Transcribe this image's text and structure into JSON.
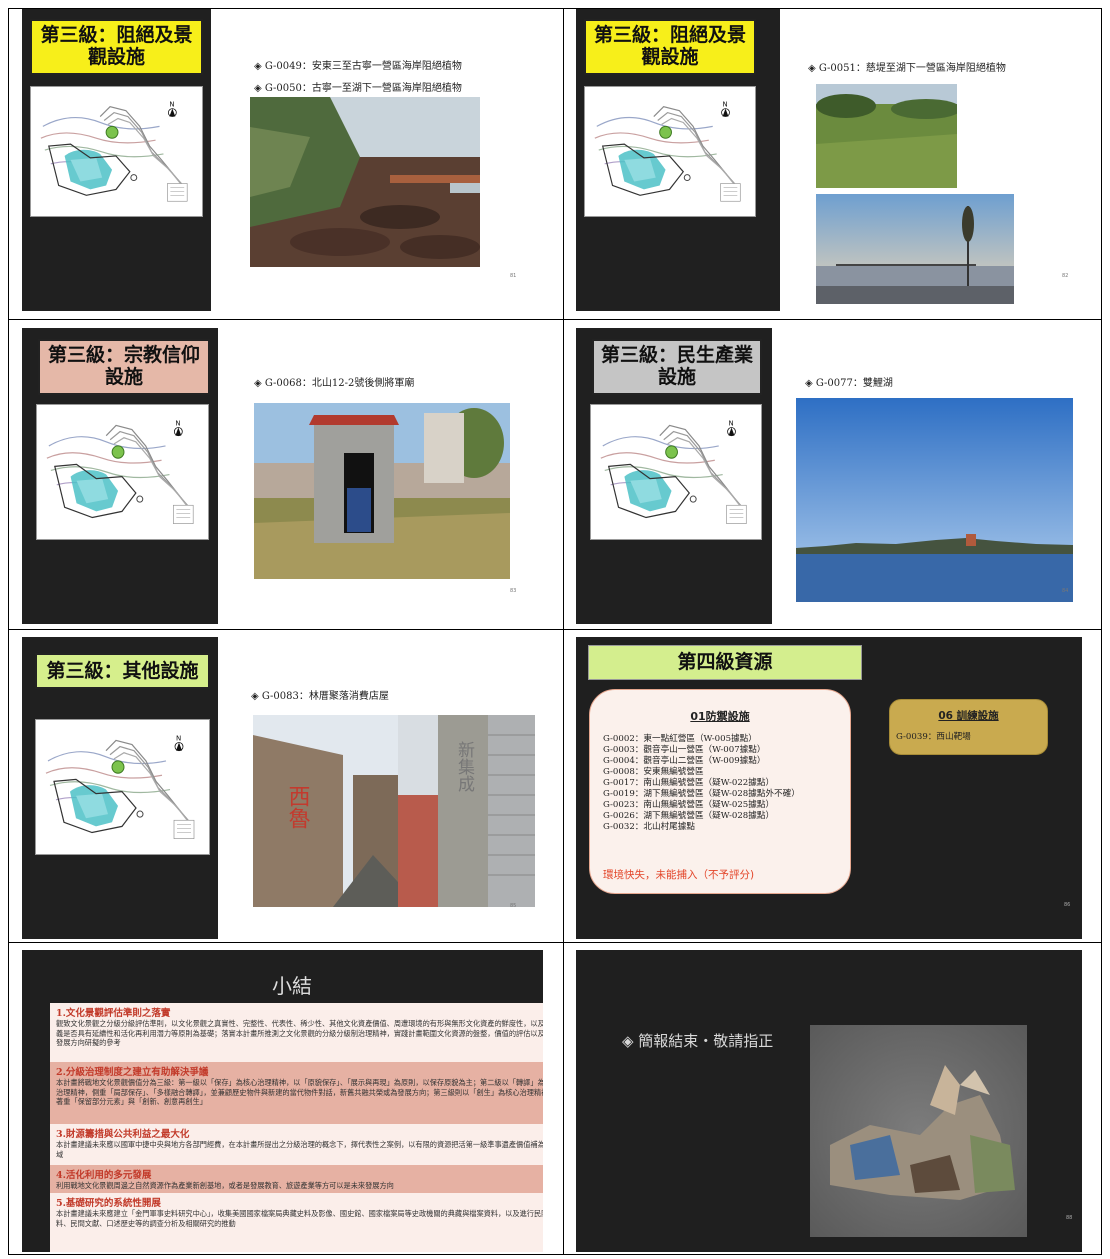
{
  "slides": {
    "s1": {
      "title": "第三級：阻絕及景觀設施",
      "captions": [
        "◈ G-0049：安東三至古寧一營區海岸阻絕植物",
        "◈ G-0050：古寧一至湖下一營區海岸阻絕植物"
      ],
      "page": "81"
    },
    "s2": {
      "title": "第三級：阻絕及景觀設施",
      "captions": [
        "◈ G-0051：慈堤至湖下一營區海岸阻絕植物"
      ],
      "page": "82"
    },
    "s3": {
      "title": "第三級：宗教信仰設施",
      "captions": [
        "◈ G-0068：北山12-2號後側將軍廟"
      ],
      "page": "83"
    },
    "s4": {
      "title": "第三級：民生產業設施",
      "captions": [
        "◈ G-0077：雙鯉湖"
      ],
      "page": "84"
    },
    "s5": {
      "title": "第三級：其他設施",
      "captions": [
        "◈ G-0083：林厝聚落消費店屋"
      ],
      "page": "85",
      "sign_right": "新集成",
      "sign_left": "西魯"
    },
    "s6": {
      "title": "第四級資源",
      "card1_title": "01防禦設施",
      "card1_items": [
        "G-0002：東一點紅營區（W-005據點）",
        "G-0003：觀音亭山一營區（W-007據點）",
        "G-0004：觀音亭山二營區（W-009據點）",
        "G-0008：安東無編號營區",
        "G-0017：南山無編號營區（疑W-022據點）",
        "G-0019：湖下無編號營區（疑W-028據點外不確）",
        "G-0023：南山無編號營區（疑W-025據點）",
        "G-0026：湖下無編號營區（疑W-028據點）",
        "G-0032：北山村尾據點"
      ],
      "card1_warning": "環境快失，未能捕入（不予評分)",
      "card2_title": "06 訓練設施",
      "card2_items": [
        "G-0039：西山靶場"
      ],
      "page": "86"
    },
    "s7": {
      "title": "小結",
      "sections": [
        {
          "heading": "1.文化景觀評估準則之落實",
          "text": "觀致文化景觀之分級分級評估準則，以文化景觀之真實性、完整性、代表性、稀少性、其他文化資產價值、周遭環境的有形與無形文化資產的鮮度性，以及其意義是否具有延續性和活化再利用潛力等原則為基礎；落實本計畫所推測之文化景觀的分級分級制治理精神，實踐計畫範圍文化資源的盤整，價值的評估以及未來發展方向研擬的參考"
        },
        {
          "heading": "2.分級治理制度之建立有助解決爭議",
          "text": "本計畫將戰地文化景觀價值分為三級：第一級以「保存」為核心治理精神，以「原貌保存」、「展示與再現」為原則，以保存原貌為主；第二級以「轉譯」為核心治理精神，側重「局部保存」、「多樣融合轉譯」，並兼顧歷史物件與新建的當代物件對話，新舊共融共榮或為發展方向；第三級則以「創生」為核心治理精神，著重「保留部分元素」與「創新、創意再創生」"
        },
        {
          "heading": "3.財源籌措與公共利益之最大化",
          "text": "本計畫建議未來應以國軍中捷中央與地方各部門經費，在本計畫所提出之分級治理的概念下，擇代表性之案例，以有限的資源把活第一級準事遺產價值補為之場域"
        },
        {
          "heading": "4.活化利用的多元發展",
          "text": "利用戰地文化景觀周邊之自然資源作為產業新創基地，或者是發展教育、旅遊產業等方可以是未來發展方向"
        },
        {
          "heading": "5.基礎研究的系統性開展",
          "text": "本計畫建議未來應建立「金門軍事史料研究中心」，收集美國國家檔案局典藏史料及影像、國史館、國家檔案局等史政機關的典藏與檔案資料，以及進行民防史料、民間文獻、口述歷史等的調查分析及相關研究的推動"
        }
      ]
    },
    "s8": {
      "text": "◈ 簡報結束・敬請指正",
      "page": "88"
    }
  },
  "colors": {
    "yellow": "#f7ef1a",
    "pink": "#e5b8a8",
    "gray": "#c5c5c5",
    "green": "#d6ef8c",
    "red": "#e3462a",
    "dark": "#1f1f1f"
  }
}
